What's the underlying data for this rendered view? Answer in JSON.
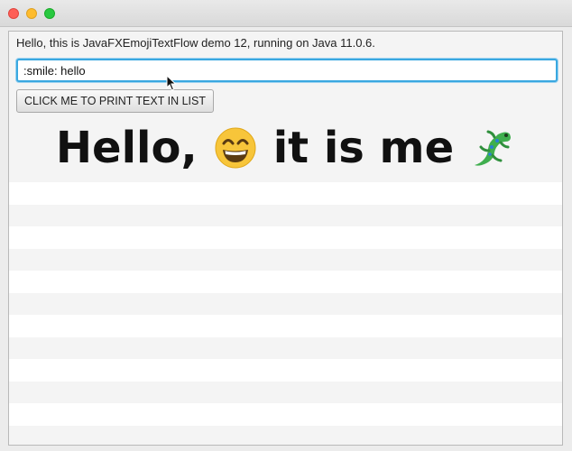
{
  "window": {
    "controls": {
      "close": "close-button",
      "minimize": "minimize-button",
      "zoom": "zoom-button"
    }
  },
  "info_label": "Hello, this is JavaFXEmojiTextFlow demo 12, running on Java 11.0.6.",
  "text_input": {
    "value": ":smile: hello"
  },
  "print_button": {
    "label": "CLICK ME TO PRINT TEXT IN LIST"
  },
  "list": {
    "first_item": {
      "part1": "Hello,",
      "emoji1": "smiling-face-icon",
      "part2": "it is me",
      "emoji2": "lizard-icon"
    }
  },
  "colors": {
    "focus_border": "#3aa8e0",
    "close": "#fe5f57",
    "minimize": "#febc2e",
    "zoom": "#28c840",
    "emoji_face": "#f7c53a",
    "lizard": "#3fae4e"
  }
}
